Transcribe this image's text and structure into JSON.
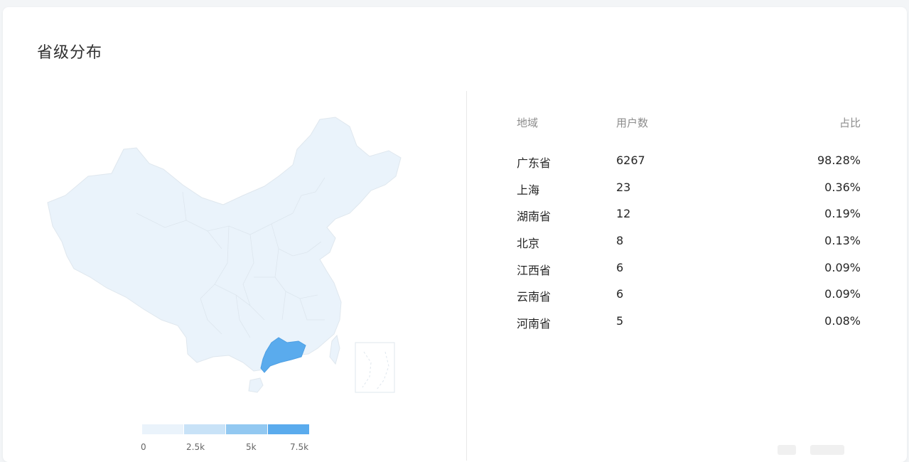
{
  "section": {
    "title": "省级分布"
  },
  "map": {
    "highlight_region": "广东省",
    "base_fill": "#eaf3fb",
    "highlight_fill": "#5aabed",
    "border_color": "#dfe7ee"
  },
  "legend": {
    "ticks": [
      "0",
      "2.5k",
      "5k",
      "7.5k"
    ],
    "colors": [
      "#eaf3fb",
      "#c8e2f7",
      "#92c8f1",
      "#5aabed"
    ]
  },
  "table": {
    "headers": {
      "region": "地域",
      "users": "用户数",
      "ratio": "占比"
    },
    "rows": [
      {
        "region": "广东省",
        "users": "6267",
        "ratio": "98.28%"
      },
      {
        "region": "上海",
        "users": "23",
        "ratio": "0.36%"
      },
      {
        "region": "湖南省",
        "users": "12",
        "ratio": "0.19%"
      },
      {
        "region": "北京",
        "users": "8",
        "ratio": "0.13%"
      },
      {
        "region": "江西省",
        "users": "6",
        "ratio": "0.09%"
      },
      {
        "region": "云南省",
        "users": "6",
        "ratio": "0.09%"
      },
      {
        "region": "河南省",
        "users": "5",
        "ratio": "0.08%"
      }
    ]
  }
}
